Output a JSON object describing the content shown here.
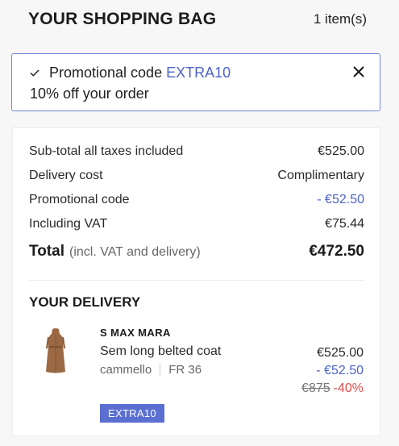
{
  "header": {
    "title": "YOUR SHOPPING BAG",
    "item_count": "1 item(s)"
  },
  "promo_banner": {
    "prefix": "Promotional code",
    "code": "EXTRA10",
    "description": "10% off your order",
    "icons": {
      "check": "check-icon",
      "close": "close-icon"
    },
    "accent_color": "#4d63c7"
  },
  "summary": {
    "rows": [
      {
        "label": "Sub-total all taxes included",
        "value": "€525.00"
      },
      {
        "label": "Delivery cost",
        "value": "Complimentary"
      },
      {
        "label": "Promotional code",
        "value": "- €52.50"
      },
      {
        "label": "Including VAT",
        "value": "€75.44"
      }
    ],
    "total": {
      "label": "Total",
      "note": "(incl. VAT and delivery)",
      "value": "€472.50"
    }
  },
  "delivery": {
    "title": "YOUR DELIVERY",
    "product": {
      "brand": "S MAX MARA",
      "name": "Sem long belted coat",
      "color": "cammello",
      "size": "FR 36",
      "price": "€525.00",
      "discount": "- €52.50",
      "original_price": "€875",
      "discount_percent": "-40%",
      "promo_tag": "EXTRA10",
      "image_icon": "coat-image"
    }
  },
  "colors": {
    "accent": "#4d63c7",
    "discount_red": "#e34b4b",
    "tag_bg": "#5b6fd0"
  }
}
